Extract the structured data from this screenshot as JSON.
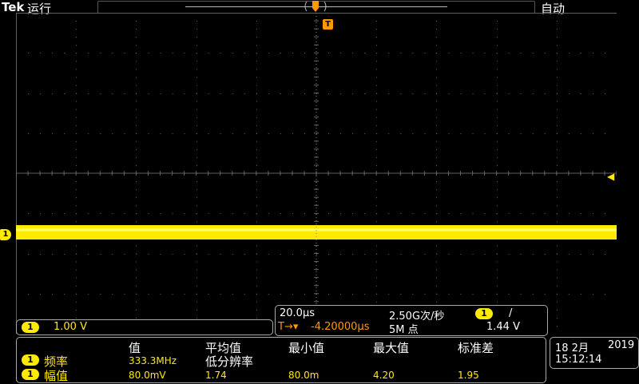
{
  "header": {
    "brand": "Tek",
    "run_state": "运行",
    "trigger_mode": "自动",
    "trigger_marker": "T"
  },
  "display": {
    "trace_color": "#ffea00",
    "grid_color": "#606060",
    "channel_marker": "1",
    "trigger_level_marker": "◀"
  },
  "channel": {
    "badge": "1",
    "scale": "1.00 V"
  },
  "horizontal": {
    "time_per_div": "20.0µs",
    "sample_rate": "2.50G次/秒",
    "trigger_badge": "1",
    "trigger_slope": "/",
    "trigger_position_icon": "T→▾",
    "trigger_position": "-4.20000µs",
    "record_length": "5M 点",
    "trigger_level": "1.44 V"
  },
  "measurements": {
    "headers": [
      "值",
      "平均值",
      "最小值",
      "最大值",
      "标准差"
    ],
    "sub_header": "低分辨率",
    "rows": [
      {
        "badge": "1",
        "name": "频率",
        "value": "333.3MHz",
        "mean": "",
        "min": "",
        "max": "",
        "std": ""
      },
      {
        "badge": "1",
        "name": "幅值",
        "value": "80.0mV",
        "mean": "1.74",
        "min": "80.0m",
        "max": "4.20",
        "std": "1.95"
      }
    ]
  },
  "datetime": {
    "date": "18 2月",
    "year": "2019",
    "time": "15:12:14"
  }
}
